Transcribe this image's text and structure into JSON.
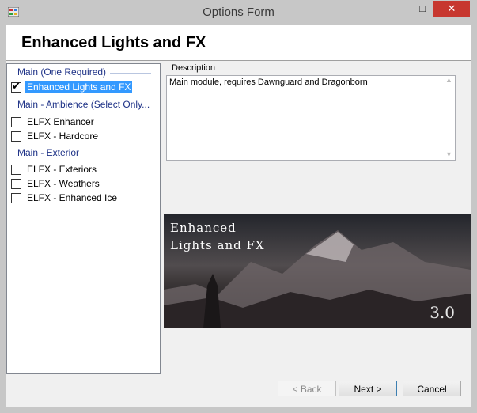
{
  "window": {
    "title": "Options Form"
  },
  "header": {
    "title": "Enhanced Lights and FX"
  },
  "options": {
    "groups": [
      {
        "label": "Main (One Required)",
        "items": [
          {
            "label": "Enhanced Lights and FX",
            "checked": true,
            "selected": true
          }
        ]
      },
      {
        "label": "Main - Ambience (Select Only...",
        "items": [
          {
            "label": "ELFX Enhancer",
            "checked": false
          },
          {
            "label": "ELFX - Hardcore",
            "checked": false
          }
        ]
      },
      {
        "label": "Main - Exterior",
        "items": [
          {
            "label": "ELFX - Exteriors",
            "checked": false
          },
          {
            "label": "ELFX - Weathers",
            "checked": false
          },
          {
            "label": "ELFX - Enhanced Ice",
            "checked": false
          }
        ]
      }
    ]
  },
  "description": {
    "label": "Description",
    "text": "Main module, requires Dawnguard and Dragonborn"
  },
  "image": {
    "title_line1": "Enhanced",
    "title_line2": "Lights and FX",
    "version": "3.0"
  },
  "buttons": {
    "back": "< Back",
    "next": "Next >",
    "cancel": "Cancel"
  },
  "colors": {
    "selection": "#3399ff",
    "group_header": "#1e3287",
    "close_button": "#c7372f"
  }
}
